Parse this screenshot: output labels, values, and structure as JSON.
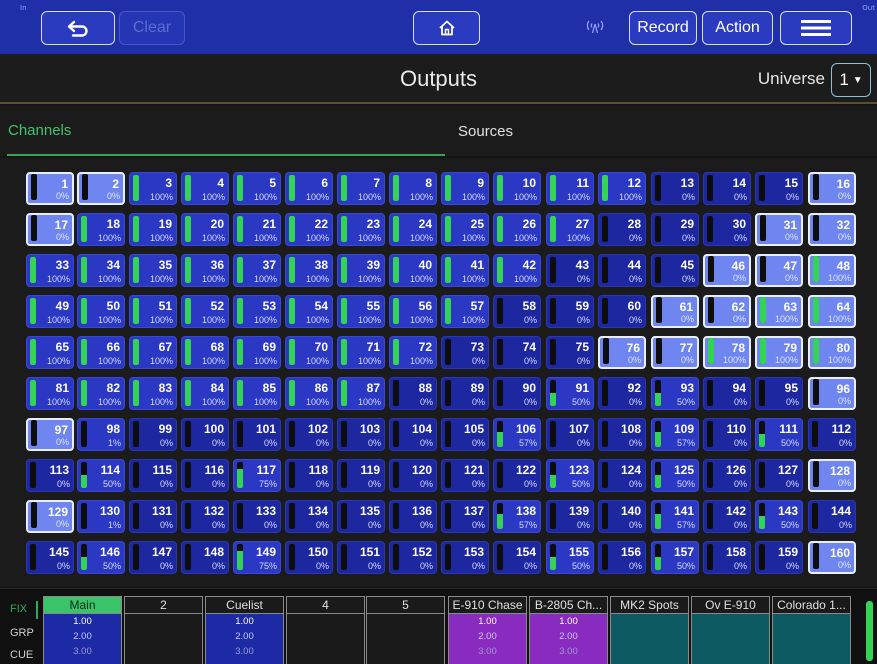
{
  "topbar": {
    "corner_left": "In",
    "corner_right": "Out",
    "back_icon": "undo-arrow-icon",
    "clear_label": "Clear",
    "home_icon": "home-icon",
    "wifi_icon": "wireless-icon",
    "record_label": "Record",
    "action_label": "Action",
    "menu_icon": "hamburger-menu-icon"
  },
  "header": {
    "title": "Outputs",
    "universe_label": "Universe",
    "universe_value": "1"
  },
  "tabs": [
    {
      "label": "Channels",
      "active": true
    },
    {
      "label": "Sources",
      "active": false
    }
  ],
  "colors": {
    "toolbar": "#1f2fa8",
    "cell_on": "#2a38c4",
    "cell_off": "#1d27a0",
    "cell_selected": "#6f86f0",
    "level_fill": "#33d455",
    "accent_green": "#2fa85a"
  },
  "channels": [
    {
      "n": "1",
      "p": "0%",
      "l": 0,
      "s": true
    },
    {
      "n": "2",
      "p": "0%",
      "l": 0,
      "s": true
    },
    {
      "n": "3",
      "p": "100%",
      "l": 100
    },
    {
      "n": "4",
      "p": "100%",
      "l": 100
    },
    {
      "n": "5",
      "p": "100%",
      "l": 100
    },
    {
      "n": "6",
      "p": "100%",
      "l": 100
    },
    {
      "n": "7",
      "p": "100%",
      "l": 100
    },
    {
      "n": "8",
      "p": "100%",
      "l": 100
    },
    {
      "n": "9",
      "p": "100%",
      "l": 100
    },
    {
      "n": "10",
      "p": "100%",
      "l": 100
    },
    {
      "n": "11",
      "p": "100%",
      "l": 100
    },
    {
      "n": "12",
      "p": "100%",
      "l": 100
    },
    {
      "n": "13",
      "p": "0%",
      "l": 0
    },
    {
      "n": "14",
      "p": "0%",
      "l": 0
    },
    {
      "n": "15",
      "p": "0%",
      "l": 0
    },
    {
      "n": "16",
      "p": "0%",
      "l": 0,
      "s": true
    },
    {
      "n": "17",
      "p": "0%",
      "l": 0,
      "s": true
    },
    {
      "n": "18",
      "p": "100%",
      "l": 100
    },
    {
      "n": "19",
      "p": "100%",
      "l": 100
    },
    {
      "n": "20",
      "p": "100%",
      "l": 100
    },
    {
      "n": "21",
      "p": "100%",
      "l": 100
    },
    {
      "n": "22",
      "p": "100%",
      "l": 100
    },
    {
      "n": "23",
      "p": "100%",
      "l": 100
    },
    {
      "n": "24",
      "p": "100%",
      "l": 100
    },
    {
      "n": "25",
      "p": "100%",
      "l": 100
    },
    {
      "n": "26",
      "p": "100%",
      "l": 100
    },
    {
      "n": "27",
      "p": "100%",
      "l": 100
    },
    {
      "n": "28",
      "p": "0%",
      "l": 0
    },
    {
      "n": "29",
      "p": "0%",
      "l": 0
    },
    {
      "n": "30",
      "p": "0%",
      "l": 0
    },
    {
      "n": "31",
      "p": "0%",
      "l": 0,
      "s": true
    },
    {
      "n": "32",
      "p": "0%",
      "l": 0,
      "s": true
    },
    {
      "n": "33",
      "p": "100%",
      "l": 100
    },
    {
      "n": "34",
      "p": "100%",
      "l": 100
    },
    {
      "n": "35",
      "p": "100%",
      "l": 100
    },
    {
      "n": "36",
      "p": "100%",
      "l": 100
    },
    {
      "n": "37",
      "p": "100%",
      "l": 100
    },
    {
      "n": "38",
      "p": "100%",
      "l": 100
    },
    {
      "n": "39",
      "p": "100%",
      "l": 100
    },
    {
      "n": "40",
      "p": "100%",
      "l": 100
    },
    {
      "n": "41",
      "p": "100%",
      "l": 100
    },
    {
      "n": "42",
      "p": "100%",
      "l": 100
    },
    {
      "n": "43",
      "p": "0%",
      "l": 0
    },
    {
      "n": "44",
      "p": "0%",
      "l": 0
    },
    {
      "n": "45",
      "p": "0%",
      "l": 0
    },
    {
      "n": "46",
      "p": "0%",
      "l": 0,
      "s": true
    },
    {
      "n": "47",
      "p": "0%",
      "l": 0,
      "s": true
    },
    {
      "n": "48",
      "p": "100%",
      "l": 100,
      "s": true
    },
    {
      "n": "49",
      "p": "100%",
      "l": 100
    },
    {
      "n": "50",
      "p": "100%",
      "l": 100
    },
    {
      "n": "51",
      "p": "100%",
      "l": 100
    },
    {
      "n": "52",
      "p": "100%",
      "l": 100
    },
    {
      "n": "53",
      "p": "100%",
      "l": 100
    },
    {
      "n": "54",
      "p": "100%",
      "l": 100
    },
    {
      "n": "55",
      "p": "100%",
      "l": 100
    },
    {
      "n": "56",
      "p": "100%",
      "l": 100
    },
    {
      "n": "57",
      "p": "100%",
      "l": 100
    },
    {
      "n": "58",
      "p": "0%",
      "l": 0
    },
    {
      "n": "59",
      "p": "0%",
      "l": 0
    },
    {
      "n": "60",
      "p": "0%",
      "l": 0
    },
    {
      "n": "61",
      "p": "0%",
      "l": 0,
      "s": true
    },
    {
      "n": "62",
      "p": "0%",
      "l": 0,
      "s": true
    },
    {
      "n": "63",
      "p": "100%",
      "l": 100,
      "s": true
    },
    {
      "n": "64",
      "p": "100%",
      "l": 100,
      "s": true
    },
    {
      "n": "65",
      "p": "100%",
      "l": 100
    },
    {
      "n": "66",
      "p": "100%",
      "l": 100
    },
    {
      "n": "67",
      "p": "100%",
      "l": 100
    },
    {
      "n": "68",
      "p": "100%",
      "l": 100
    },
    {
      "n": "69",
      "p": "100%",
      "l": 100
    },
    {
      "n": "70",
      "p": "100%",
      "l": 100
    },
    {
      "n": "71",
      "p": "100%",
      "l": 100
    },
    {
      "n": "72",
      "p": "100%",
      "l": 100
    },
    {
      "n": "73",
      "p": "0%",
      "l": 0
    },
    {
      "n": "74",
      "p": "0%",
      "l": 0
    },
    {
      "n": "75",
      "p": "0%",
      "l": 0
    },
    {
      "n": "76",
      "p": "0%",
      "l": 0,
      "s": true
    },
    {
      "n": "77",
      "p": "0%",
      "l": 0,
      "s": true
    },
    {
      "n": "78",
      "p": "100%",
      "l": 100,
      "s": true
    },
    {
      "n": "79",
      "p": "100%",
      "l": 100,
      "s": true
    },
    {
      "n": "80",
      "p": "100%",
      "l": 100,
      "s": true
    },
    {
      "n": "81",
      "p": "100%",
      "l": 100
    },
    {
      "n": "82",
      "p": "100%",
      "l": 100
    },
    {
      "n": "83",
      "p": "100%",
      "l": 100
    },
    {
      "n": "84",
      "p": "100%",
      "l": 100
    },
    {
      "n": "85",
      "p": "100%",
      "l": 100
    },
    {
      "n": "86",
      "p": "100%",
      "l": 100
    },
    {
      "n": "87",
      "p": "100%",
      "l": 100
    },
    {
      "n": "88",
      "p": "0%",
      "l": 0
    },
    {
      "n": "89",
      "p": "0%",
      "l": 0
    },
    {
      "n": "90",
      "p": "0%",
      "l": 0
    },
    {
      "n": "91",
      "p": "50%",
      "l": 50
    },
    {
      "n": "92",
      "p": "0%",
      "l": 0
    },
    {
      "n": "93",
      "p": "50%",
      "l": 50
    },
    {
      "n": "94",
      "p": "0%",
      "l": 0
    },
    {
      "n": "95",
      "p": "0%",
      "l": 0
    },
    {
      "n": "96",
      "p": "0%",
      "l": 0,
      "s": true
    },
    {
      "n": "97",
      "p": "0%",
      "l": 0,
      "s": true
    },
    {
      "n": "98",
      "p": "1%",
      "l": 1
    },
    {
      "n": "99",
      "p": "0%",
      "l": 0
    },
    {
      "n": "100",
      "p": "0%",
      "l": 0
    },
    {
      "n": "101",
      "p": "0%",
      "l": 0
    },
    {
      "n": "102",
      "p": "0%",
      "l": 0
    },
    {
      "n": "103",
      "p": "0%",
      "l": 0
    },
    {
      "n": "104",
      "p": "0%",
      "l": 0
    },
    {
      "n": "105",
      "p": "0%",
      "l": 0
    },
    {
      "n": "106",
      "p": "57%",
      "l": 57
    },
    {
      "n": "107",
      "p": "0%",
      "l": 0
    },
    {
      "n": "108",
      "p": "0%",
      "l": 0
    },
    {
      "n": "109",
      "p": "57%",
      "l": 57
    },
    {
      "n": "110",
      "p": "0%",
      "l": 0
    },
    {
      "n": "111",
      "p": "50%",
      "l": 50
    },
    {
      "n": "112",
      "p": "0%",
      "l": 0
    },
    {
      "n": "113",
      "p": "0%",
      "l": 0
    },
    {
      "n": "114",
      "p": "50%",
      "l": 50
    },
    {
      "n": "115",
      "p": "0%",
      "l": 0
    },
    {
      "n": "116",
      "p": "0%",
      "l": 0
    },
    {
      "n": "117",
      "p": "75%",
      "l": 75
    },
    {
      "n": "118",
      "p": "0%",
      "l": 0
    },
    {
      "n": "119",
      "p": "0%",
      "l": 0
    },
    {
      "n": "120",
      "p": "0%",
      "l": 0
    },
    {
      "n": "121",
      "p": "0%",
      "l": 0
    },
    {
      "n": "122",
      "p": "0%",
      "l": 0
    },
    {
      "n": "123",
      "p": "50%",
      "l": 50
    },
    {
      "n": "124",
      "p": "0%",
      "l": 0
    },
    {
      "n": "125",
      "p": "50%",
      "l": 50
    },
    {
      "n": "126",
      "p": "0%",
      "l": 0
    },
    {
      "n": "127",
      "p": "0%",
      "l": 0
    },
    {
      "n": "128",
      "p": "0%",
      "l": 0,
      "s": true
    },
    {
      "n": "129",
      "p": "0%",
      "l": 0,
      "s": true
    },
    {
      "n": "130",
      "p": "1%",
      "l": 1
    },
    {
      "n": "131",
      "p": "0%",
      "l": 0
    },
    {
      "n": "132",
      "p": "0%",
      "l": 0
    },
    {
      "n": "133",
      "p": "0%",
      "l": 0
    },
    {
      "n": "134",
      "p": "0%",
      "l": 0
    },
    {
      "n": "135",
      "p": "0%",
      "l": 0
    },
    {
      "n": "136",
      "p": "0%",
      "l": 0
    },
    {
      "n": "137",
      "p": "0%",
      "l": 0
    },
    {
      "n": "138",
      "p": "57%",
      "l": 57
    },
    {
      "n": "139",
      "p": "0%",
      "l": 0
    },
    {
      "n": "140",
      "p": "0%",
      "l": 0
    },
    {
      "n": "141",
      "p": "57%",
      "l": 57
    },
    {
      "n": "142",
      "p": "0%",
      "l": 0
    },
    {
      "n": "143",
      "p": "50%",
      "l": 50
    },
    {
      "n": "144",
      "p": "0%",
      "l": 0
    },
    {
      "n": "145",
      "p": "0%",
      "l": 0
    },
    {
      "n": "146",
      "p": "50%",
      "l": 50
    },
    {
      "n": "147",
      "p": "0%",
      "l": 0
    },
    {
      "n": "148",
      "p": "0%",
      "l": 0
    },
    {
      "n": "149",
      "p": "75%",
      "l": 75
    },
    {
      "n": "150",
      "p": "0%",
      "l": 0
    },
    {
      "n": "151",
      "p": "0%",
      "l": 0
    },
    {
      "n": "152",
      "p": "0%",
      "l": 0
    },
    {
      "n": "153",
      "p": "0%",
      "l": 0
    },
    {
      "n": "154",
      "p": "0%",
      "l": 0
    },
    {
      "n": "155",
      "p": "50%",
      "l": 50
    },
    {
      "n": "156",
      "p": "0%",
      "l": 0
    },
    {
      "n": "157",
      "p": "50%",
      "l": 50
    },
    {
      "n": "158",
      "p": "0%",
      "l": 0
    },
    {
      "n": "159",
      "p": "0%",
      "l": 0
    },
    {
      "n": "160",
      "p": "0%",
      "l": 0,
      "s": true
    }
  ],
  "playback": {
    "modes": {
      "fix": "FIX",
      "grp": "GRP",
      "cue": "CUE"
    },
    "faders": [
      {
        "label": "Main",
        "style": "main blue",
        "values": [
          "1.00",
          "2.00",
          "3.00"
        ]
      },
      {
        "label": "2",
        "style": "empty",
        "values": []
      },
      {
        "label": "Cuelist",
        "style": "blue",
        "values": [
          "1.00",
          "2.00",
          "3.00"
        ]
      },
      {
        "label": "4",
        "style": "empty",
        "values": []
      },
      {
        "label": "5",
        "style": "empty",
        "values": []
      },
      {
        "label": "E-910 Chase",
        "style": "purple",
        "values": [
          "1.00",
          "2.00",
          "3.00"
        ]
      },
      {
        "label": "B-2805 Ch...",
        "style": "purple",
        "values": [
          "1.00",
          "2.00",
          "3.00"
        ]
      },
      {
        "label": "MK2 Spots",
        "style": "teal",
        "values": []
      },
      {
        "label": "Ov E-910",
        "style": "teal",
        "values": []
      },
      {
        "label": "Colorado 1...",
        "style": "teal",
        "values": []
      }
    ]
  }
}
